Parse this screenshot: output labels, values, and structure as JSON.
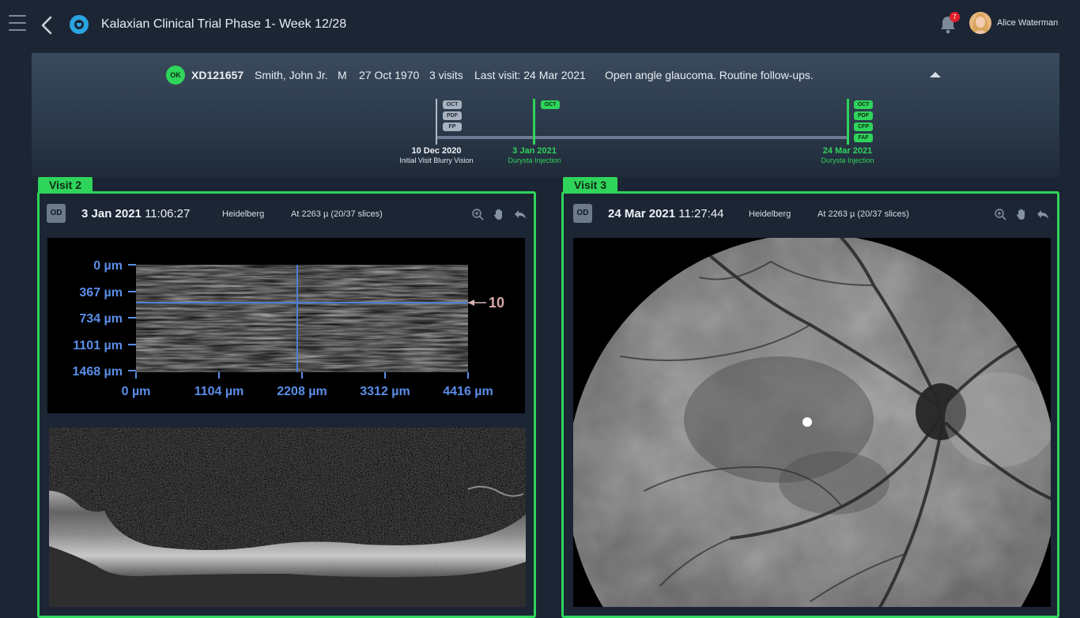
{
  "topbar": {
    "title": "Kalaxian Clinical Trial Phase 1- Week 12/28",
    "notification_count": "7",
    "user_name": "Alice Waterman"
  },
  "patient": {
    "status": "OK",
    "id": "XD121657",
    "name": "Smith, John Jr.",
    "sex": "M",
    "dob": "27 Oct 1970",
    "visits": "3 visits",
    "last_visit": "Last visit: 24 Mar 2021",
    "diagnosis": "Open angle glaucoma. Routine follow-ups."
  },
  "timeline": {
    "events": [
      {
        "date": "10 Dec 2020",
        "label": "Initial Visit Blurry Vision",
        "tags": [
          "OCT",
          "PDF",
          "FP"
        ]
      },
      {
        "date": "3 Jan 2021",
        "label": "Durysta Injection",
        "tags": [
          "OCT"
        ]
      },
      {
        "date": "24 Mar 2021",
        "label": "Durysta Injection",
        "tags": [
          "OCT",
          "PDF",
          "CFP",
          "FAF"
        ]
      }
    ]
  },
  "visits": [
    {
      "tab": "Visit 2",
      "eye": "OD",
      "date": "3 Jan 2021",
      "time": "11:06:27",
      "device": "Heidelberg",
      "slice": "At 2263 µ (20/37 slices)",
      "oct_map": {
        "y_labels": [
          "0 µm",
          "367 µm",
          "734 µm",
          "1101 µm",
          "1468 µm"
        ],
        "x_labels": [
          "0 µm",
          "1104 µm",
          "2208 µm",
          "3312 µm",
          "4416 µm"
        ],
        "slice_marker": "10"
      }
    },
    {
      "tab": "Visit 3",
      "eye": "OD",
      "date": "24 Mar 2021",
      "time": "11:27:44",
      "device": "Heidelberg",
      "slice": "At 2263 µ (20/37 slices)"
    }
  ],
  "colors": {
    "background": "#1c2534",
    "accent_green": "#2fd45a",
    "logo_blue": "#2aa4e0",
    "badge_red": "#e0202b",
    "axis_blue": "#5a8ee8"
  },
  "icons": [
    "menu-icon",
    "back-arrow-icon",
    "app-logo-icon",
    "bell-icon",
    "zoom-in-icon",
    "pan-hand-icon",
    "undo-arrow-icon"
  ]
}
